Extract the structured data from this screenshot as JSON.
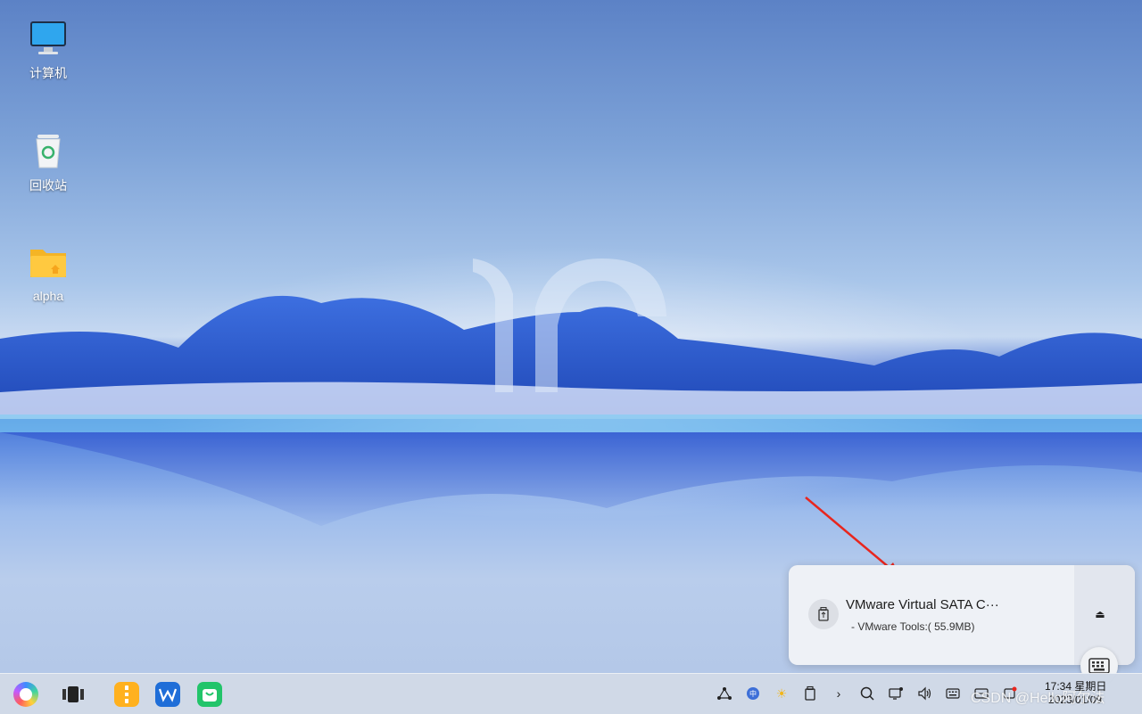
{
  "desktop": {
    "icons": [
      {
        "label": "计算机",
        "icon": "computer-icon"
      },
      {
        "label": "回收站",
        "icon": "trash-icon"
      },
      {
        "label": "alpha",
        "icon": "folder-icon"
      }
    ]
  },
  "notification": {
    "title": "VMware Virtual SATA C···",
    "subtitle": "- VMware Tools:( 55.9MB)",
    "icon": "usb-drive-icon",
    "eject_icon": "⏏"
  },
  "taskbar": {
    "apps": [
      "launcher-icon",
      "multitask-view-icon",
      "file-manager-icon",
      "wps-icon",
      "app-store-icon"
    ],
    "tray": [
      "network-icon",
      "input-method-icon",
      "brightness-icon",
      "usb-icon",
      "expand-icon",
      "search-icon",
      "display-icon",
      "volume-icon",
      "keyboard-icon",
      "screen-keyboard-icon",
      "notification-icon"
    ],
    "time": "17:34 星期日",
    "date": "2023/01/09"
  },
  "watermark": "CSDN @Hello阿尔法",
  "colors": {
    "accent": "#2a57c9",
    "arrow": "#e8261e"
  }
}
